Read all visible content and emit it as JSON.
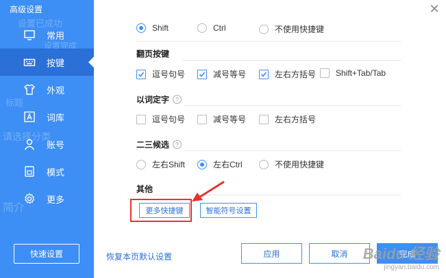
{
  "window": {
    "title": "高级设置",
    "close_glyph": "✕"
  },
  "background_ghost_text": [
    "设置已成功",
    "设置完成",
    "标题",
    "请选择分类",
    "简介"
  ],
  "sidebar": {
    "items": [
      {
        "label": "常用",
        "icon": "monitor-icon",
        "active": false
      },
      {
        "label": "按键",
        "icon": "keyboard-icon",
        "active": true
      },
      {
        "label": "外观",
        "icon": "shirt-icon",
        "active": false
      },
      {
        "label": "词库",
        "icon": "letter-a-icon",
        "active": false
      },
      {
        "label": "账号",
        "icon": "user-icon",
        "active": false
      },
      {
        "label": "模式",
        "icon": "mode-icon",
        "active": false
      },
      {
        "label": "更多",
        "icon": "gear-icon",
        "active": false
      }
    ],
    "quick_settings_label": "快速设置"
  },
  "shift_options": [
    {
      "label": "Shift",
      "checked": true
    },
    {
      "label": "Ctrl",
      "checked": false
    },
    {
      "label": "不使用快捷键",
      "checked": false
    }
  ],
  "page_turn": {
    "title": "翻页按键",
    "options": [
      {
        "label": "逗号句号",
        "checked": true
      },
      {
        "label": "减号等号",
        "checked": true
      },
      {
        "label": "左右方括号",
        "checked": true
      },
      {
        "label": "Shift+Tab/Tab",
        "checked": false
      }
    ]
  },
  "word_select": {
    "title": "以词定字",
    "help": "?",
    "options": [
      {
        "label": "逗号句号",
        "checked": false
      },
      {
        "label": "减号等号",
        "checked": false
      },
      {
        "label": "左右方括号",
        "checked": false
      }
    ]
  },
  "second_third": {
    "title": "二三候选",
    "help": "?",
    "options": [
      {
        "label": "左右Shift",
        "checked": false
      },
      {
        "label": "左右Ctrl",
        "checked": true
      },
      {
        "label": "不使用快捷键",
        "checked": false
      }
    ]
  },
  "other": {
    "title": "其他",
    "more_shortcuts_label": "更多快捷键",
    "symbol_settings_label": "智能符号设置"
  },
  "footer": {
    "restore_default_label": "恢复本页默认设置",
    "apply_label": "应用",
    "cancel_label": "取消",
    "done_label": "完成"
  },
  "colors": {
    "accent": "#3d8ef5",
    "sidebar_active": "#2a70d6",
    "highlight_box": "#e8322e"
  },
  "watermark": {
    "brand": "Baidu 经验",
    "url": "jingyan.baidu.com"
  }
}
